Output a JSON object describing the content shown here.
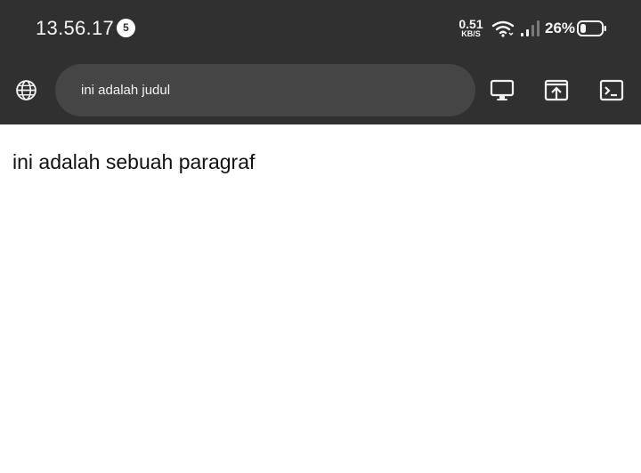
{
  "status_bar": {
    "time": "13.56.17",
    "notification_count": "5",
    "net_speed_value": "0.51",
    "net_speed_unit": "KB/S",
    "battery_percent": "26%",
    "icons": [
      "wifi-icon",
      "signal-icon",
      "battery-icon"
    ]
  },
  "toolbar": {
    "url_text": "ini adalah judul",
    "icons": [
      "globe-icon",
      "desktop-view-icon",
      "open-in-browser-icon",
      "terminal-icon"
    ]
  },
  "page": {
    "paragraph": "ini adalah sebuah paragraf"
  },
  "colors": {
    "chrome_bg": "#303030",
    "url_bar_bg": "#454545",
    "page_bg": "#ffffff",
    "text_light": "#f5f5f5"
  }
}
